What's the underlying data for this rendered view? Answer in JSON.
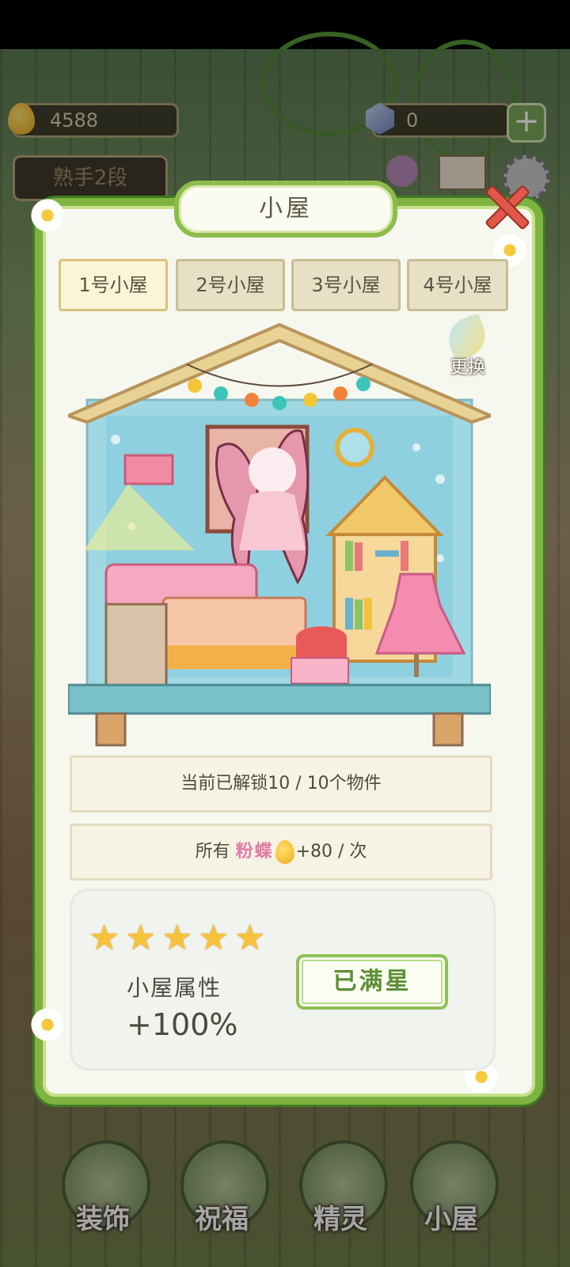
{
  "hud": {
    "currency_value": "4588",
    "gem_value": "0",
    "plus_icon": "plus-icon",
    "drop_icon": "nectar-drop-icon",
    "gem_icon": "crystal-gem-icon"
  },
  "background": {
    "badge_text": "熟手2段",
    "label_1": "心",
    "label_2": "邮件",
    "label_3": "设置"
  },
  "dialog": {
    "title": "小屋",
    "close_icon": "close-icon",
    "tabs": [
      {
        "label": "1号小屋",
        "active": true
      },
      {
        "label": "2号小屋",
        "active": false
      },
      {
        "label": "3号小屋",
        "active": false
      },
      {
        "label": "4号小屋",
        "active": false
      }
    ],
    "change_label": "更换",
    "unlock_text": "当前已解锁10 / 10个物件",
    "bonus": {
      "prefix": "所有",
      "highlight": "粉蝶",
      "suffix": "+80 / 次"
    },
    "stars": {
      "filled": 5,
      "total": 5
    },
    "attr_label": "小屋属性",
    "attr_value": "+100%",
    "max_button": "已满星"
  },
  "bottom_nav": [
    {
      "label": "装饰"
    },
    {
      "label": "祝福"
    },
    {
      "label": "精灵"
    },
    {
      "label": "小屋"
    }
  ],
  "colors": {
    "frame_green": "#7fb33f",
    "star_gold": "#f5c23a",
    "highlight_pink": "#e27aa4",
    "close_red": "#e0584a"
  }
}
